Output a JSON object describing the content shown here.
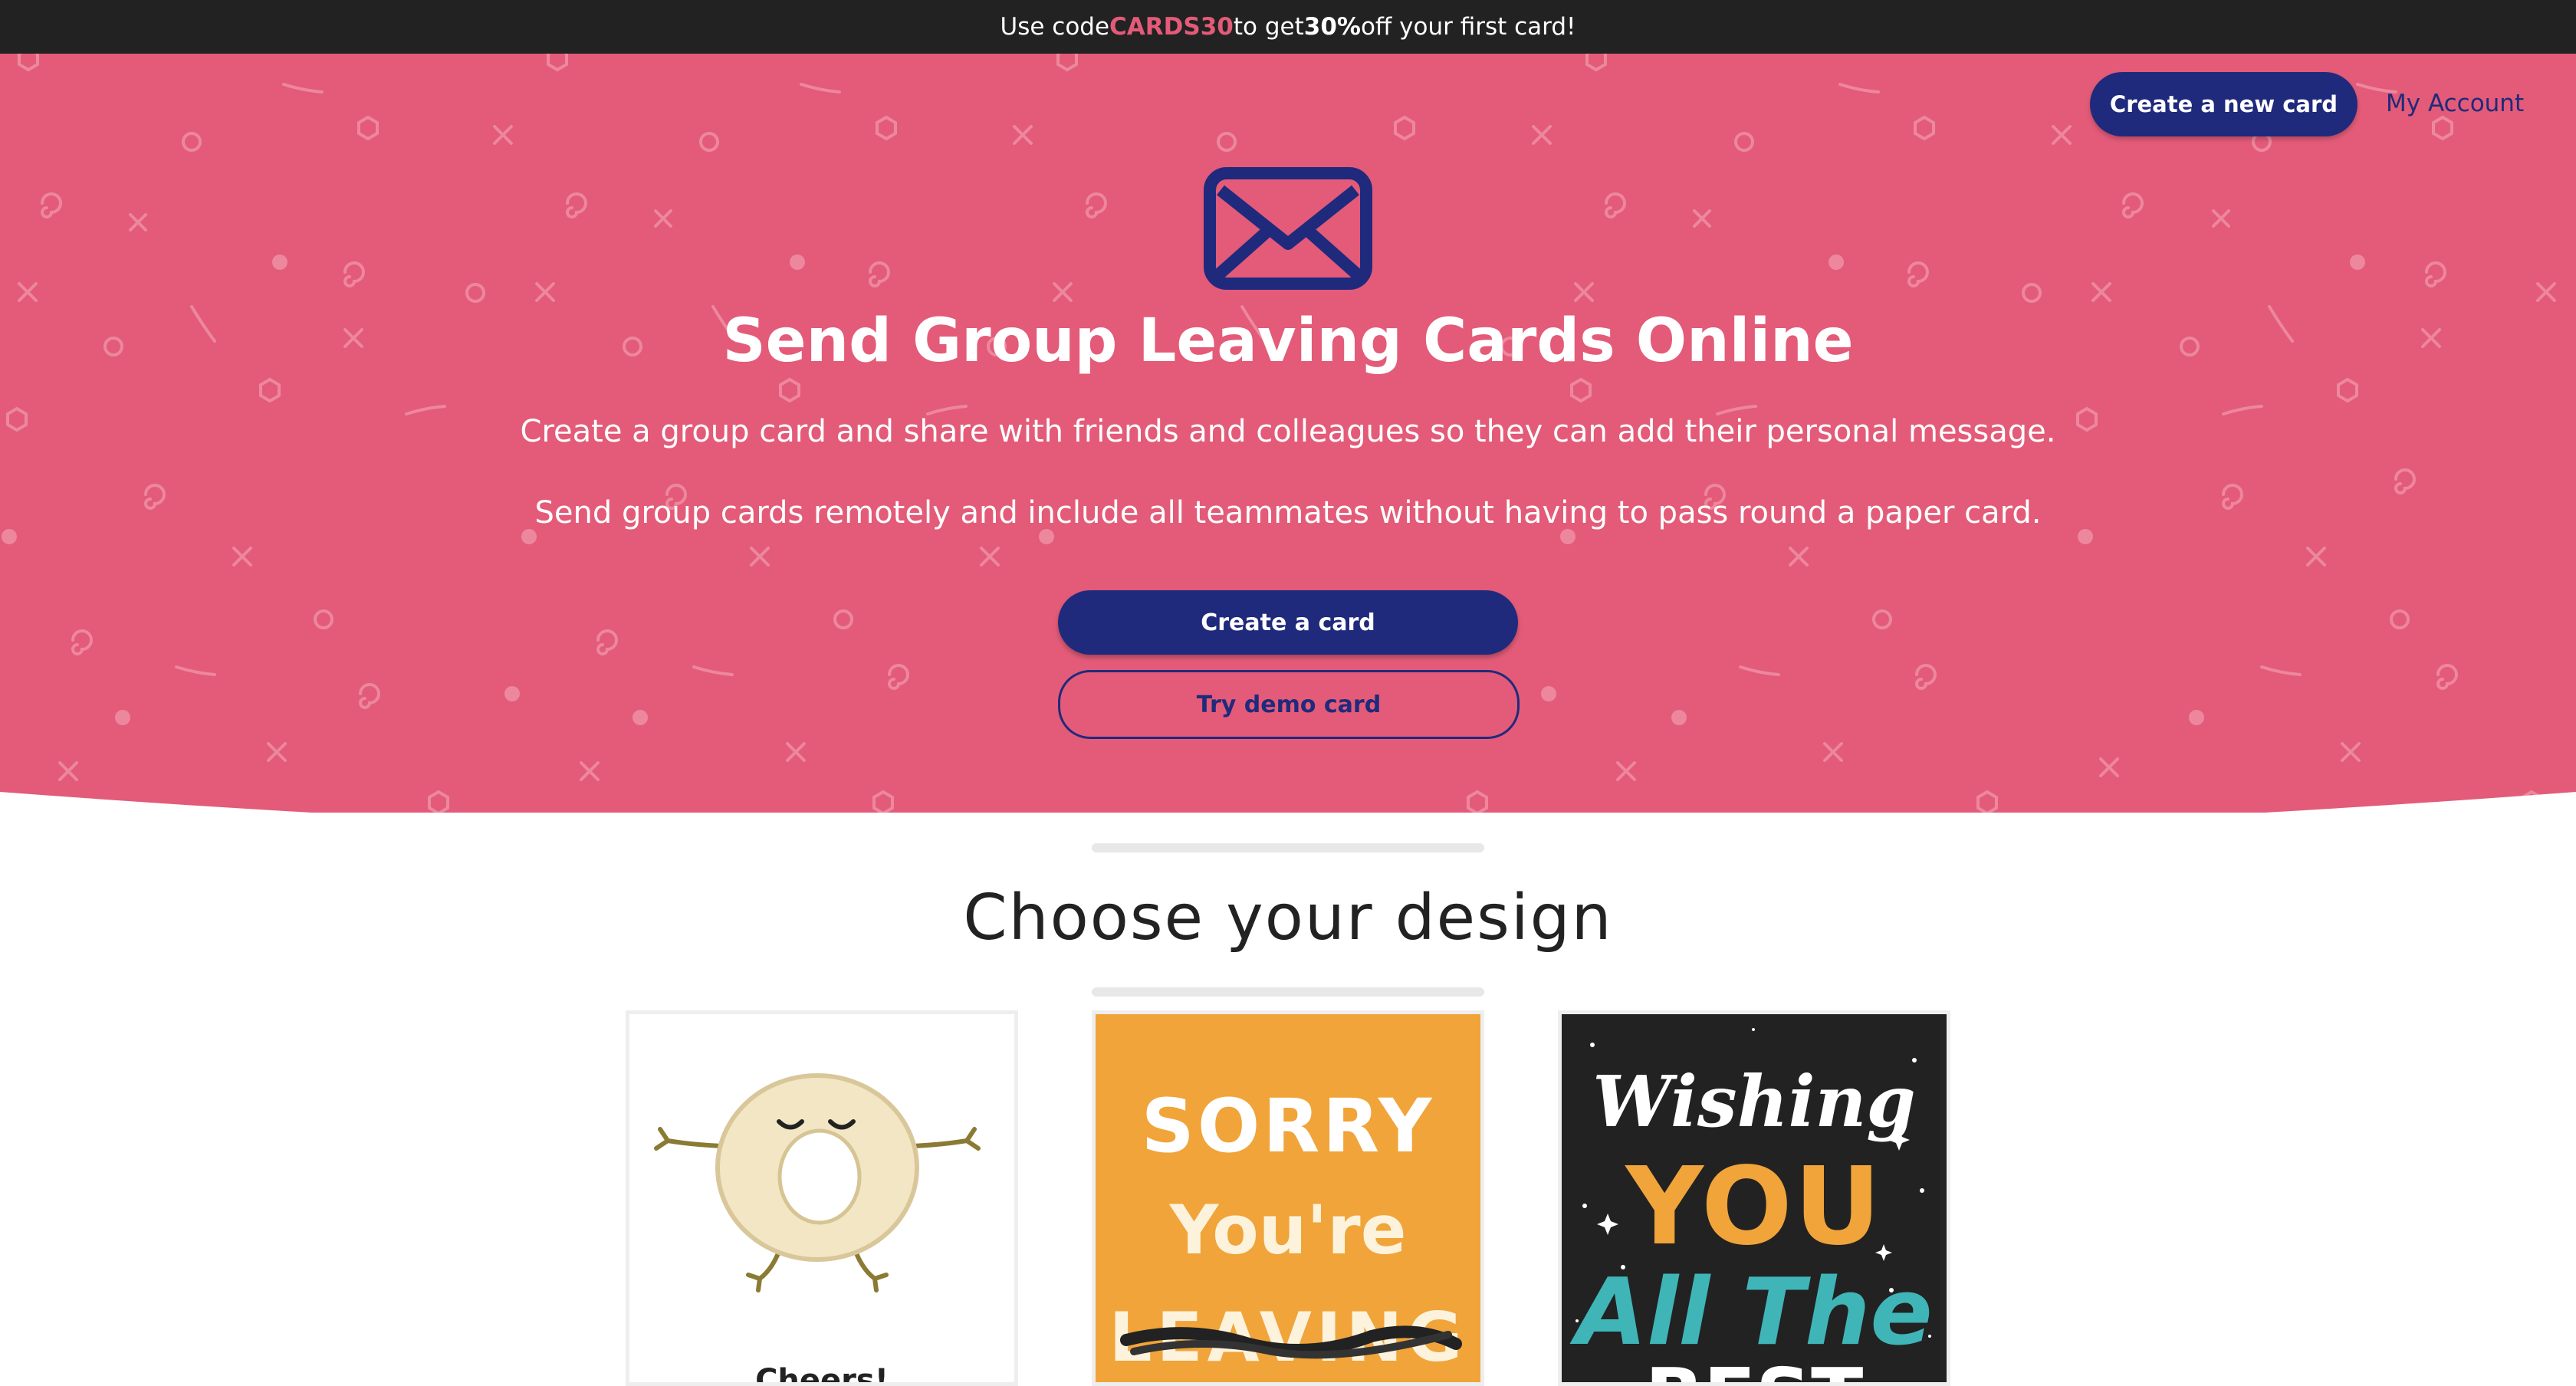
{
  "promo": {
    "prefix": "Use code ",
    "code": "CARDS30",
    "middle": " to get ",
    "percent": "30%",
    "suffix": " off your first card!"
  },
  "nav": {
    "create_new_card": "Create a new card",
    "my_account": "My Account"
  },
  "hero": {
    "title": "Send Group Leaving Cards Online",
    "paragraph1": "Create a group card and share with friends and colleagues so they can add their personal message.",
    "paragraph2": "Send group cards remotely and include all teammates without having to pass round a paper card.",
    "create_button": "Create a card",
    "demo_button": "Try demo card"
  },
  "designs": {
    "title": "Choose your design",
    "cards": [
      {
        "label": "Cheers!"
      },
      {
        "line1": "SORRY",
        "line2": "You're",
        "line3": "LEAVING"
      },
      {
        "line1": "Wishing",
        "line2": "YOU",
        "line3": "All The",
        "line4": "BEST"
      }
    ]
  },
  "colors": {
    "promo_bg": "#222222",
    "hero_bg": "#e35b78",
    "navy": "#1f2a7c",
    "promo_code": "#e35b78",
    "card_orange": "#f0a43a",
    "card_dark": "#222222",
    "card_teal": "#3fb5b8"
  },
  "icons": {
    "envelope": "envelope-icon"
  }
}
